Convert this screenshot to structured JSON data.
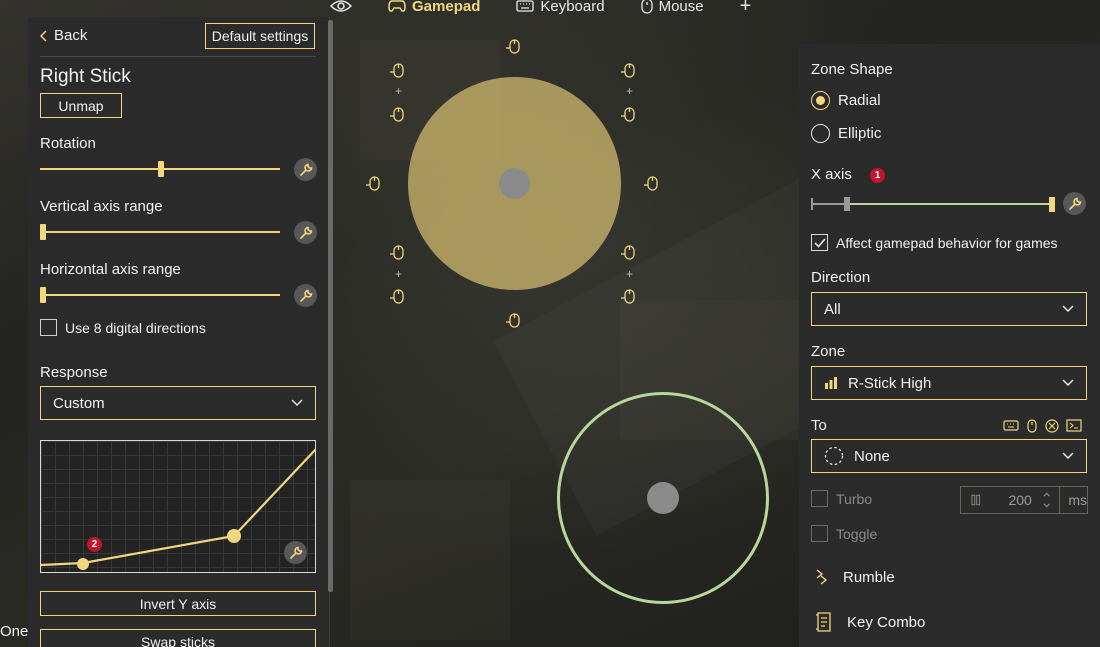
{
  "top_nav": {
    "items": [
      {
        "label": "",
        "icon": "eye-icon"
      },
      {
        "label": "Gamepad",
        "icon": "gamepad-icon",
        "active": true
      },
      {
        "label": "Keyboard",
        "icon": "keyboard-icon"
      },
      {
        "label": "Mouse",
        "icon": "mouse-icon"
      },
      {
        "label": "+",
        "icon": "add-icon"
      }
    ]
  },
  "left_panel": {
    "back_label": "Back",
    "default_settings_label": "Default settings",
    "title": "Right Stick",
    "unmap_label": "Unmap",
    "rotation_label": "Rotation",
    "rotation_value": 0.52,
    "vertical_axis_label": "Vertical axis range",
    "vertical_axis_value": 0.0,
    "horizontal_axis_label": "Horizontal axis range",
    "horizontal_axis_value": 0.0,
    "digital_directions_label": "Use 8 digital directions",
    "digital_directions_checked": false,
    "response_label": "Response",
    "response_value": "Custom",
    "curve_badge": "2",
    "invert_y_label": "Invert Y axis",
    "swap_sticks_label": "Swap sticks"
  },
  "footer_left_label": "One",
  "right_panel": {
    "zone_shape_label": "Zone Shape",
    "radial_label": "Radial",
    "elliptic_label": "Elliptic",
    "zone_shape_selected": "Radial",
    "x_axis_label": "X axis",
    "x_axis_badge": "1",
    "affect_label": "Affect gamepad behavior for games",
    "affect_checked": true,
    "direction_label": "Direction",
    "direction_value": "All",
    "zone_label": "Zone",
    "zone_value": "R-Stick High",
    "to_label": "To",
    "to_value": "None",
    "turbo_label": "Turbo",
    "toggle_label": "Toggle",
    "turbo_value": "200",
    "turbo_unit": "ms",
    "rumble_label": "Rumble",
    "key_combo_label": "Key Combo"
  },
  "colors": {
    "accent": "#f3d77e",
    "zone_fill": "#c9b56a",
    "ring": "#b7d89a",
    "panel": "#2b2b2b",
    "badge": "#c4152f"
  }
}
